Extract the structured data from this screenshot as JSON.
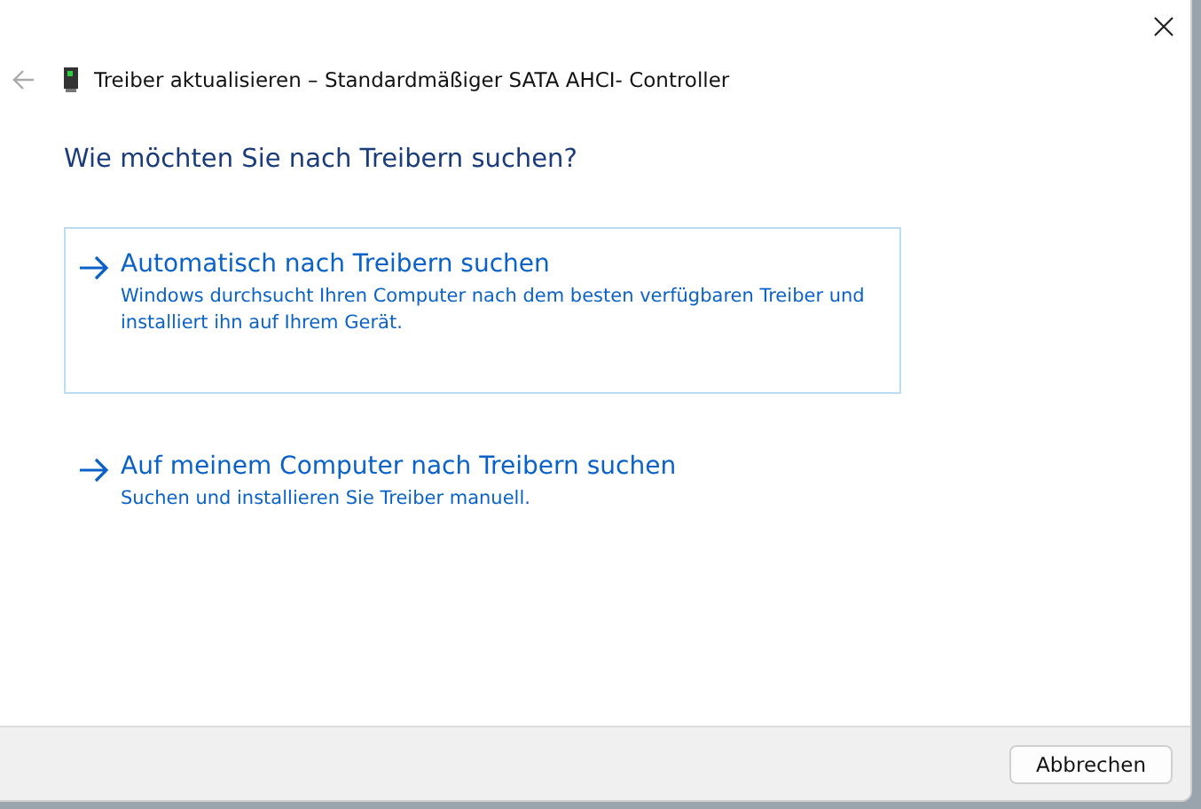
{
  "window": {
    "title": "Treiber aktualisieren – Standardmäßiger SATA AHCI- Controller"
  },
  "heading": "Wie möchten Sie nach Treibern suchen?",
  "options": [
    {
      "title": "Automatisch nach Treibern suchen",
      "description": "Windows durchsucht Ihren Computer nach dem besten verfügbaren Treiber und installiert ihn auf Ihrem Gerät.",
      "selected": true
    },
    {
      "title": "Auf meinem Computer nach Treibern suchen",
      "description": "Suchen und installieren Sie Treiber manuell.",
      "selected": false
    }
  ],
  "buttons": [
    "Abbrechen"
  ]
}
